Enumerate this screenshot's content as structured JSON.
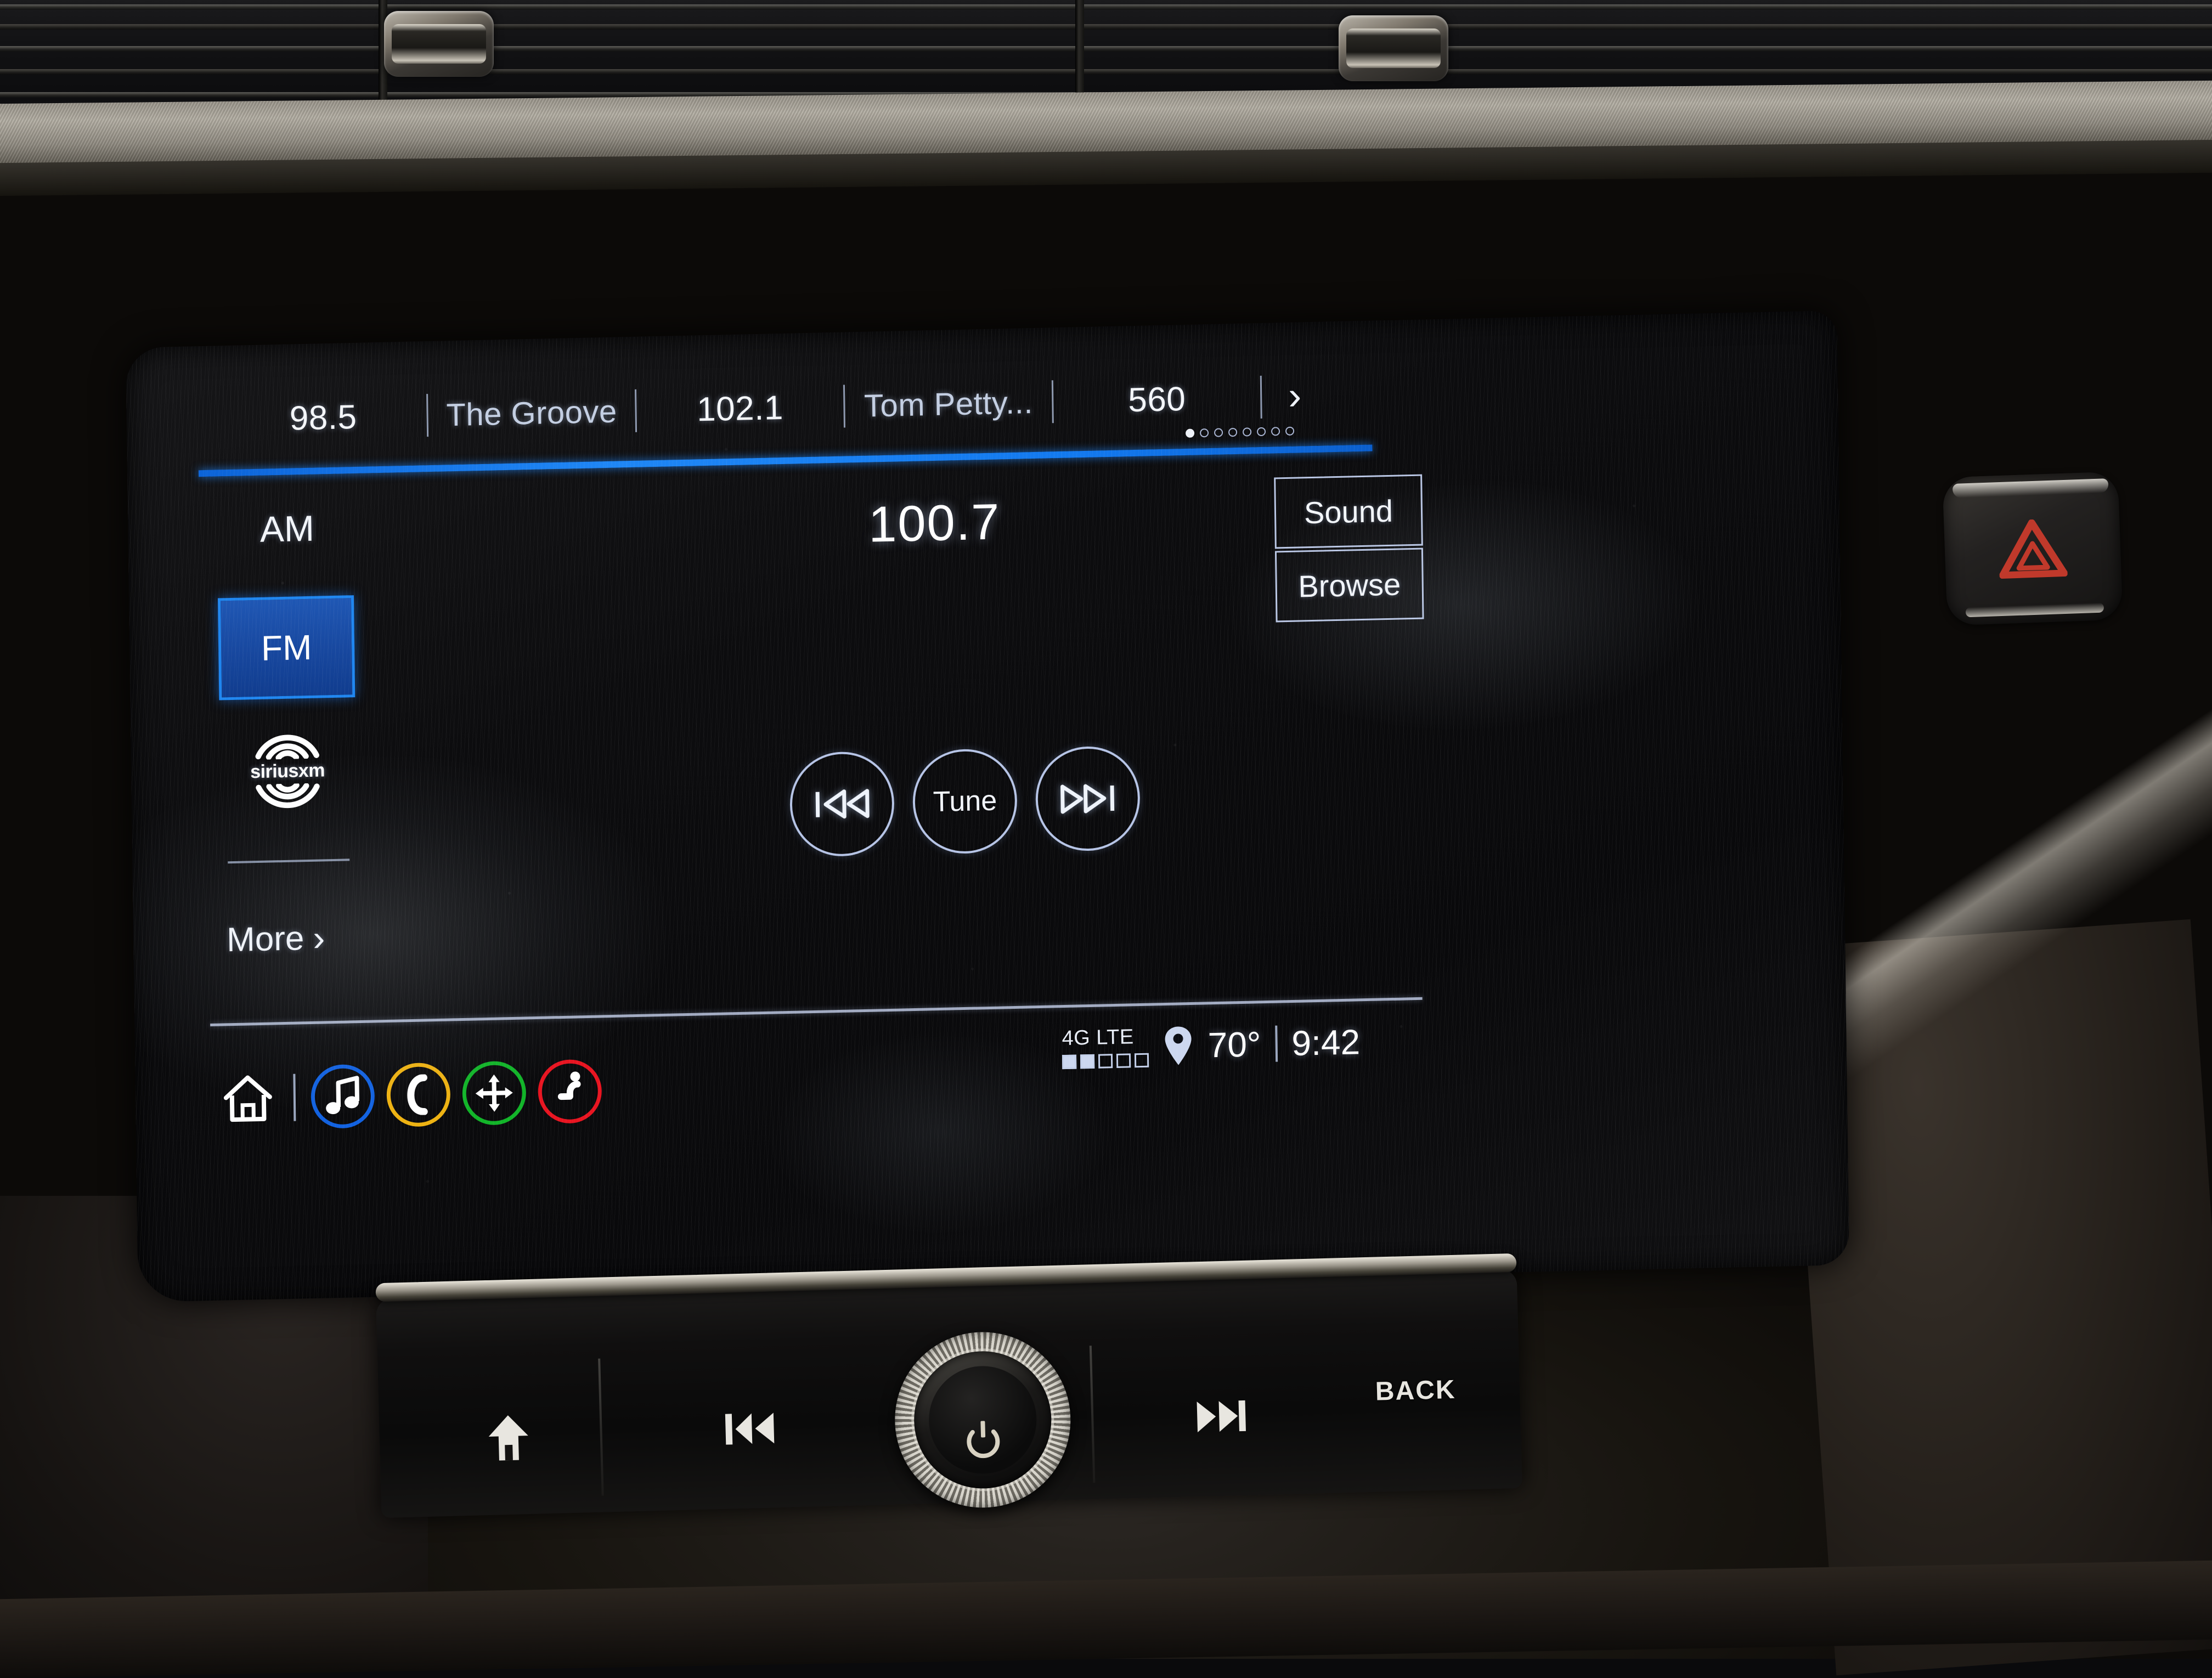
{
  "screen": {
    "presets": [
      {
        "label": "98.5",
        "type": "frequency"
      },
      {
        "label": "The Groove",
        "type": "station-name"
      },
      {
        "label": "102.1",
        "type": "frequency"
      },
      {
        "label": "Tom Petty...",
        "type": "station-name"
      },
      {
        "label": "560",
        "type": "frequency"
      }
    ],
    "preset_next_icon": "chevron-right-icon",
    "preset_next_glyph": "›",
    "page_dots": {
      "total": 8,
      "active_index": 0
    },
    "bands": {
      "am_label": "AM",
      "fm_label": "FM",
      "selected": "FM",
      "satellite_label": "siriusxm",
      "satellite_icon": "siriusxm-logo-icon"
    },
    "more_label": "More",
    "more_chevron": "›",
    "frequency": "100.7",
    "side_buttons": {
      "sound_label": "Sound",
      "browse_label": "Browse"
    },
    "transport": {
      "prev_icon": "skip-previous-icon",
      "tune_label": "Tune",
      "next_icon": "skip-next-icon"
    },
    "status": {
      "network_label": "4G LTE",
      "signal_bars_total": 5,
      "signal_bars_filled": 2,
      "location_icon": "location-pin-icon",
      "temperature": "70°",
      "clock": "9:42"
    },
    "navbar": [
      {
        "name": "home",
        "icon": "home-icon",
        "color": "#ffffff",
        "circled": false
      },
      {
        "name": "audio",
        "icon": "music-note-icon",
        "color": "#1161e0",
        "circled": true
      },
      {
        "name": "phone",
        "icon": "phone-handset-icon",
        "color": "#eeb211",
        "circled": true
      },
      {
        "name": "navigation",
        "icon": "navigation-arrows-icon",
        "color": "#11b428",
        "circled": true
      },
      {
        "name": "comfort",
        "icon": "seat-icon",
        "color": "#e81420",
        "circled": true
      }
    ],
    "colors": {
      "accent_blue": "#1e86f5",
      "fm_fill": "#17479e",
      "fm_border": "#1f86f0",
      "text": "#f2f5fa",
      "border": "#b9c6e4"
    }
  },
  "hardware": {
    "hazard_button": {
      "name": "hazard-lights",
      "icon": "hazard-triangle-icon",
      "color": "#c0392b"
    },
    "panel_buttons": [
      {
        "name": "home",
        "icon": "home-icon",
        "label": ""
      },
      {
        "name": "previous-track",
        "icon": "skip-previous-icon",
        "label": ""
      },
      {
        "name": "power-volume-knob",
        "icon": "power-icon",
        "label": ""
      },
      {
        "name": "next-track",
        "icon": "skip-next-icon",
        "label": ""
      },
      {
        "name": "back",
        "icon": "back-label",
        "label": "BACK"
      }
    ]
  }
}
